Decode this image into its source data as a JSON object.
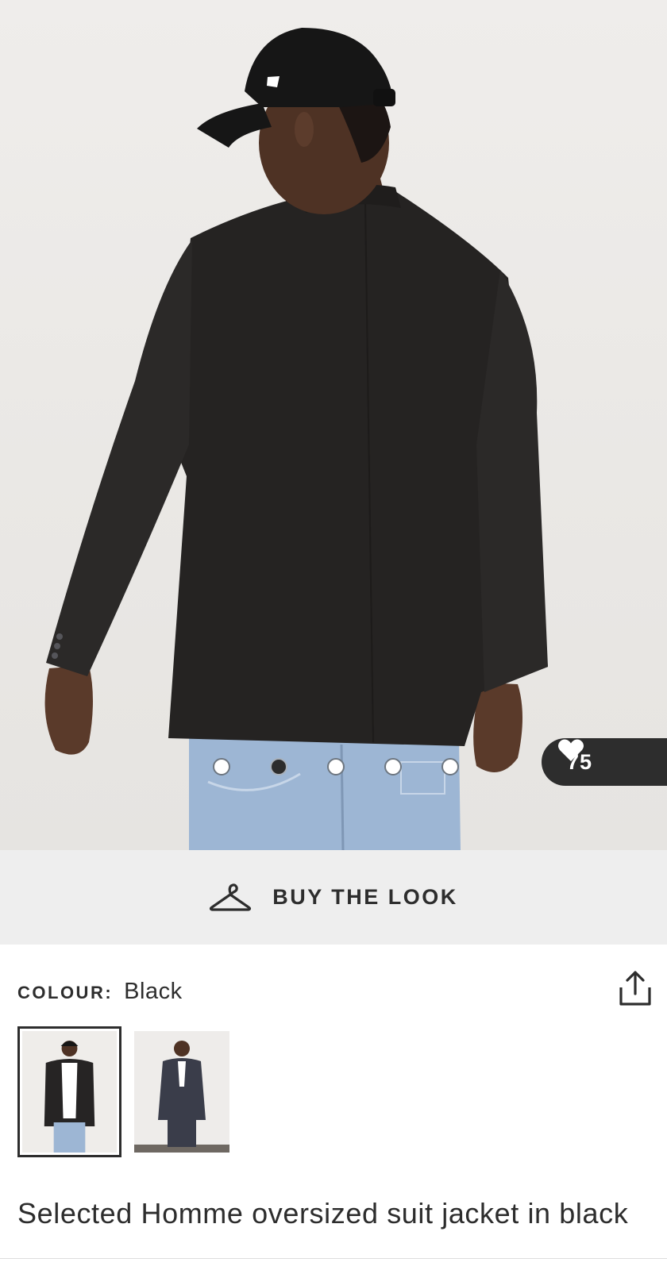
{
  "product": {
    "title": "Selected Homme oversized suit jacket in black",
    "save_count": "75",
    "buy_the_look_label": "BUY THE LOOK",
    "colour_label": "COLOUR:",
    "colour_value": "Black"
  },
  "gallery": {
    "image_count": 5,
    "active_index": 1
  },
  "colours": {
    "jacket": "#252322",
    "jeans": "#9bb4d3",
    "skin": "#5a3a2a",
    "accent_dark": "#2d2d2d",
    "strip_bg": "#eeeeee"
  },
  "icons": {
    "save": "heart-icon",
    "buy_the_look": "hanger-icon",
    "share": "share-icon"
  }
}
